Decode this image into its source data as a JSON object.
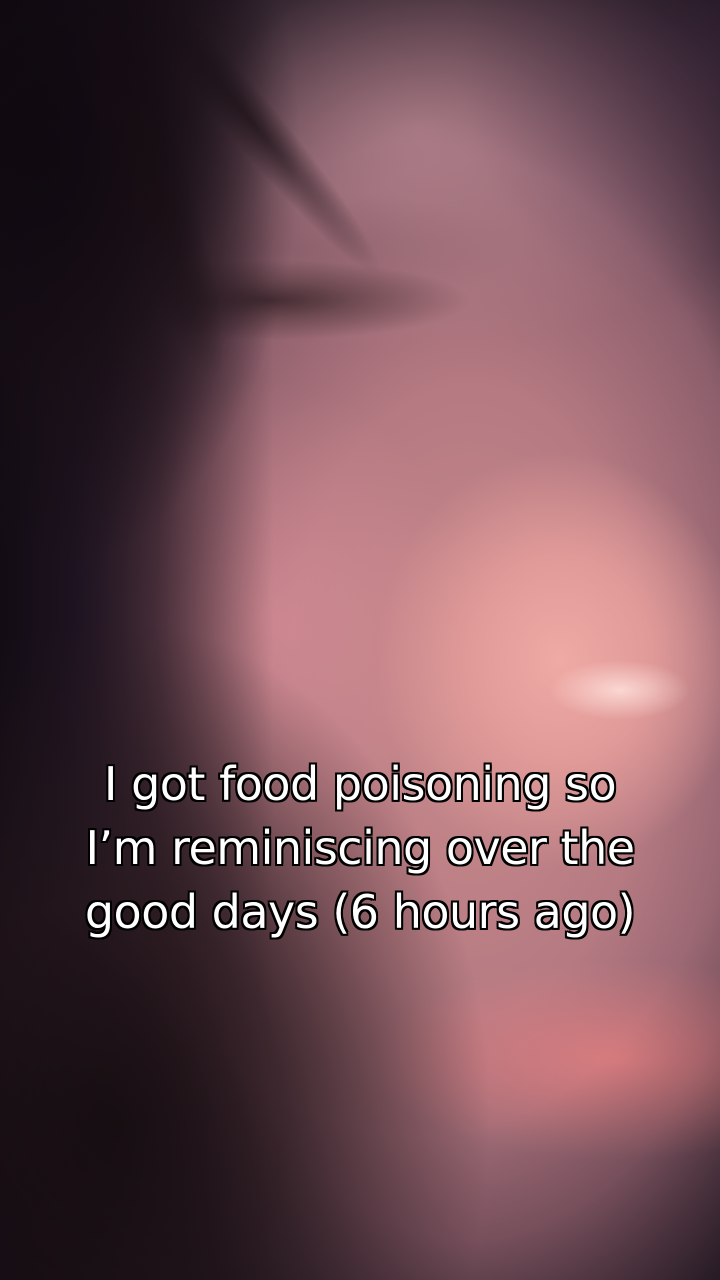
{
  "caption": {
    "lines": [
      "I got food poisoning so",
      "I’m reminiscing over the",
      "good days (6 hours ago)"
    ]
  }
}
